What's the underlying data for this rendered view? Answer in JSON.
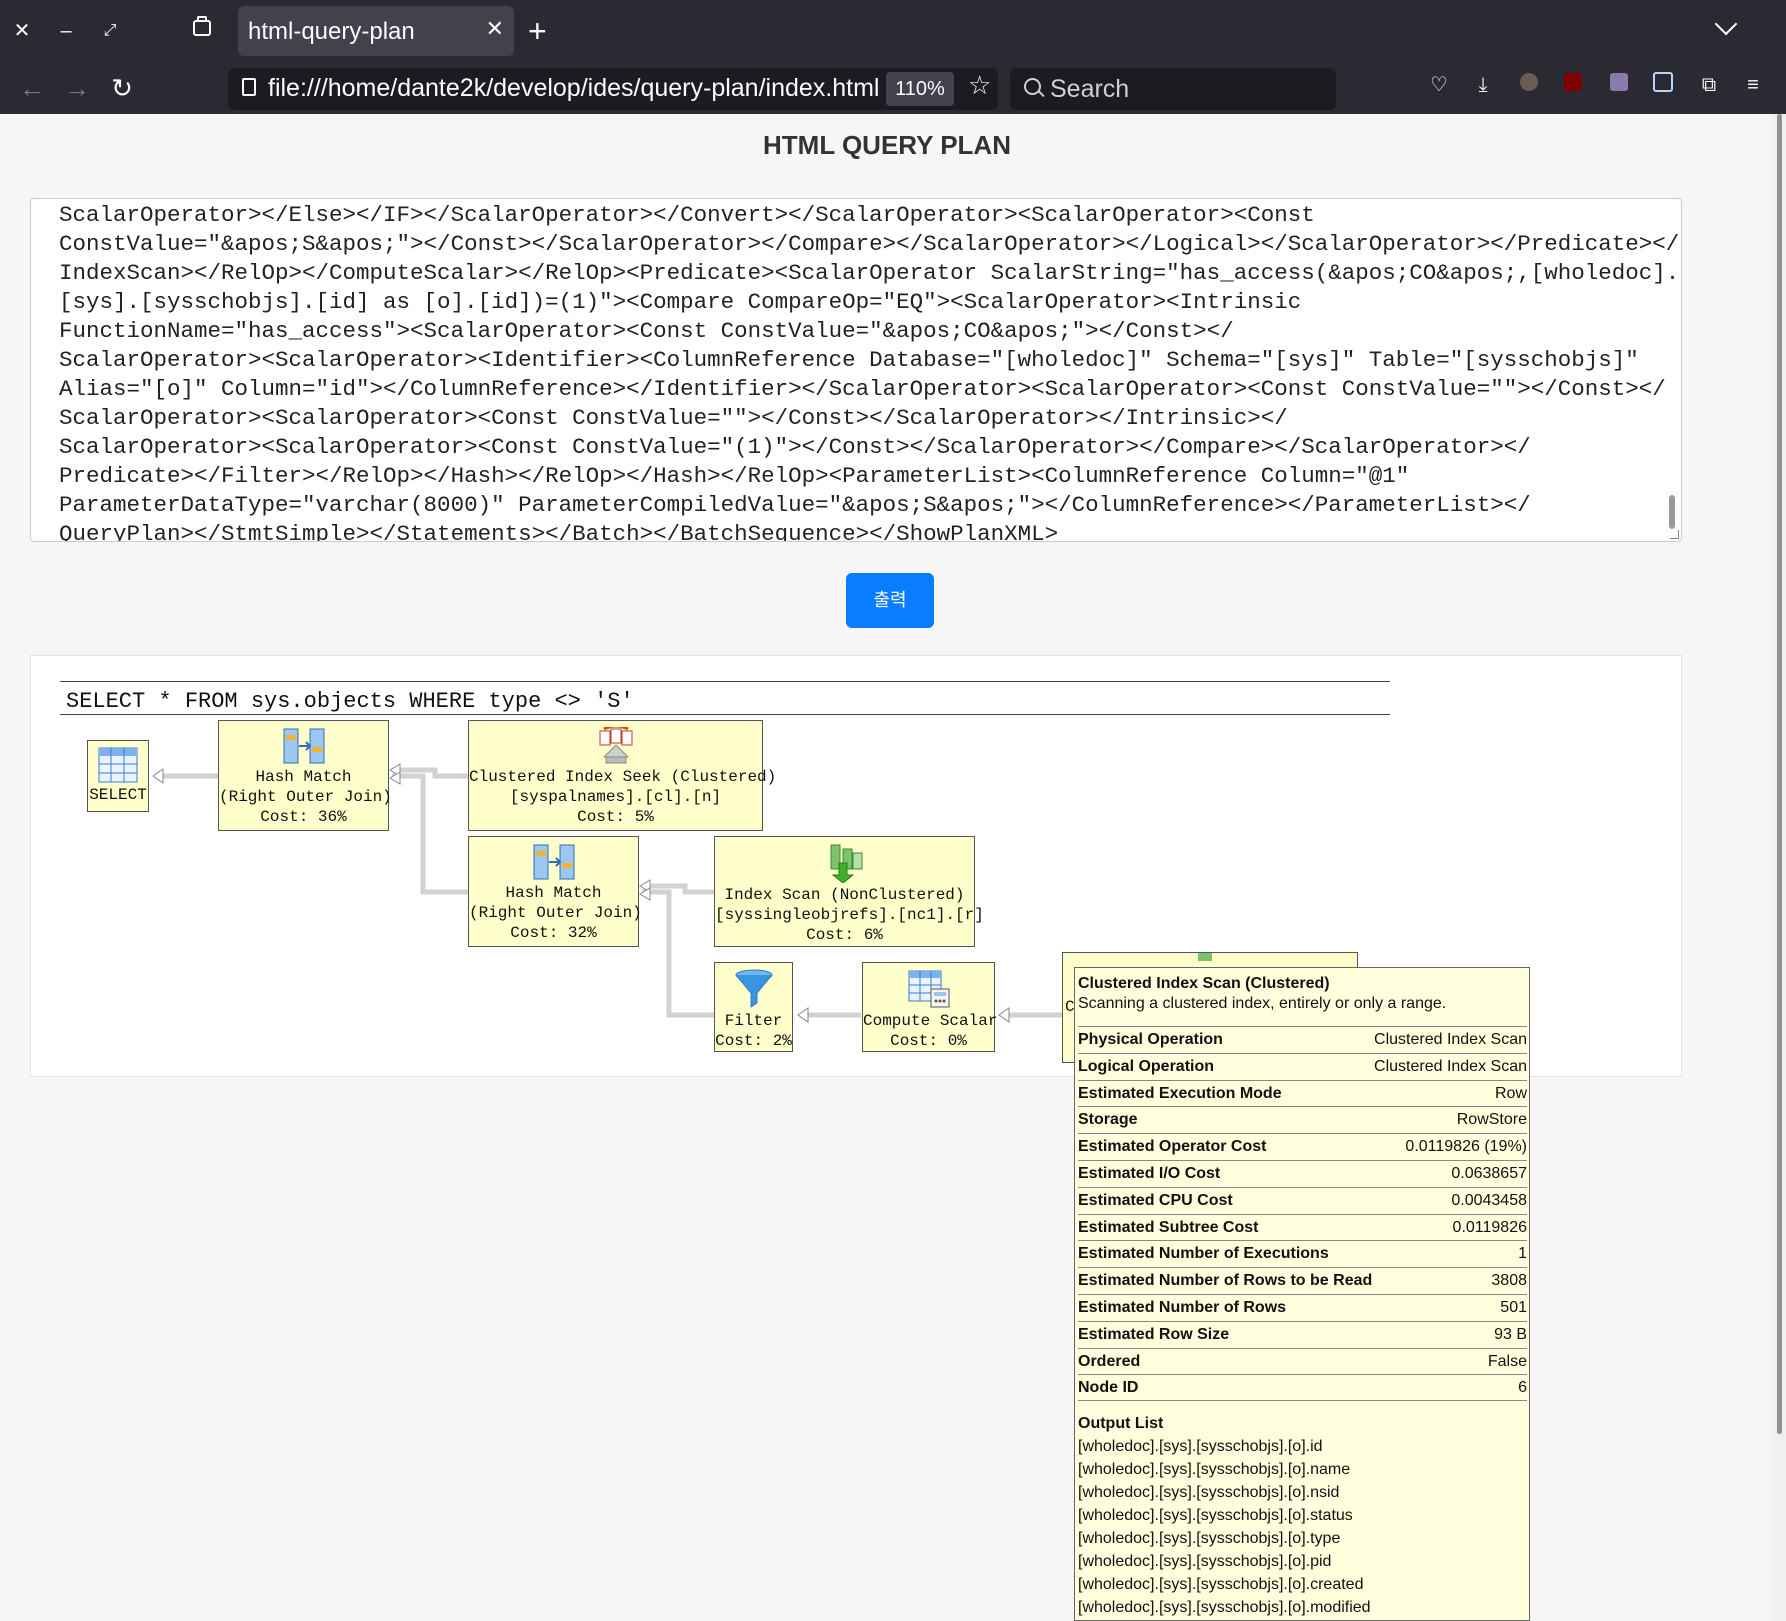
{
  "browser": {
    "tab_title": "html-query-plan",
    "url": "file:///home/dante2k/develop/ides/query-plan/index.html",
    "zoom": "110%",
    "search_placeholder": "Search"
  },
  "page": {
    "title": "HTML QUERY PLAN",
    "xml_lines": [
      "ScalarOperator></Else></IF></ScalarOperator></Convert></ScalarOperator><ScalarOperator><Const",
      "ConstValue=\"&apos;S&apos;\"></Const></ScalarOperator></Compare></ScalarOperator></Logical></ScalarOperator></Predicate></",
      "IndexScan></RelOp></ComputeScalar></RelOp><Predicate><ScalarOperator ScalarString=\"has_access(&apos;CO&apos;,[wholedoc].",
      "[sys].[sysschobjs].[id] as [o].[id])=(1)\"><Compare CompareOp=\"EQ\"><ScalarOperator><Intrinsic",
      "FunctionName=\"has_access\"><ScalarOperator><Const ConstValue=\"&apos;CO&apos;\"></Const></",
      "ScalarOperator><ScalarOperator><Identifier><ColumnReference Database=\"[wholedoc]\" Schema=\"[sys]\" Table=\"[sysschobjs]\"",
      "Alias=\"[o]\" Column=\"id\"></ColumnReference></Identifier></ScalarOperator><ScalarOperator><Const ConstValue=\"\"></Const></",
      "ScalarOperator><ScalarOperator><Const ConstValue=\"\"></Const></ScalarOperator></Intrinsic></",
      "ScalarOperator><ScalarOperator><Const ConstValue=\"(1)\"></Const></ScalarOperator></Compare></ScalarOperator></",
      "Predicate></Filter></RelOp></Hash></RelOp></Hash></RelOp><ParameterList><ColumnReference Column=\"@1\"",
      "ParameterDataType=\"varchar(8000)\" ParameterCompiledValue=\"&apos;S&apos;\"></ColumnReference></ParameterList></",
      "QueryPlan></StmtSimple></Statements></Batch></BatchSequence></ShowPlanXML>"
    ],
    "render_button": "출력"
  },
  "plan": {
    "statement": "SELECT * FROM sys.objects WHERE type <> 'S'",
    "nodes": {
      "select": {
        "l1": "SELECT"
      },
      "hash1": {
        "l1": "Hash Match",
        "l2": "(Right Outer Join)",
        "cost": "Cost: 36%"
      },
      "seek": {
        "l1": "Clustered Index Seek (Clustered)",
        "l2": "[syspalnames].[cl].[n]",
        "cost": "Cost: 5%"
      },
      "hash2": {
        "l1": "Hash Match",
        "l2": "(Right Outer Join)",
        "cost": "Cost: 32%"
      },
      "iscan": {
        "l1": "Index Scan (NonClustered)",
        "l2": "[syssingleobjrefs].[nc1].[r]",
        "cost": "Cost: 6%"
      },
      "filter": {
        "l1": "Filter",
        "cost": "Cost: 2%"
      },
      "compute": {
        "l1": "Compute Scalar",
        "cost": "Cost: 0%"
      },
      "cscan": {
        "l1": "C"
      }
    }
  },
  "tooltip": {
    "title": "Clustered Index Scan (Clustered)",
    "description": "Scanning a clustered index, entirely or only a range.",
    "rows": [
      {
        "k": "Physical Operation",
        "v": "Clustered Index Scan"
      },
      {
        "k": "Logical Operation",
        "v": "Clustered Index Scan"
      },
      {
        "k": "Estimated Execution Mode",
        "v": "Row"
      },
      {
        "k": "Storage",
        "v": "RowStore"
      },
      {
        "k": "Estimated Operator Cost",
        "v": "0.0119826 (19%)"
      },
      {
        "k": "Estimated I/O Cost",
        "v": "0.0638657"
      },
      {
        "k": "Estimated CPU Cost",
        "v": "0.0043458"
      },
      {
        "k": "Estimated Subtree Cost",
        "v": "0.0119826"
      },
      {
        "k": "Estimated Number of Executions",
        "v": "1"
      },
      {
        "k": "Estimated Number of Rows to be Read",
        "v": "3808"
      },
      {
        "k": "Estimated Number of Rows",
        "v": "501"
      },
      {
        "k": "Estimated Row Size",
        "v": "93 B"
      },
      {
        "k": "Ordered",
        "v": "False"
      },
      {
        "k": "Node ID",
        "v": "6"
      }
    ],
    "output_title": "Output List",
    "output_list": [
      "[wholedoc].[sys].[sysschobjs].[o].id",
      "[wholedoc].[sys].[sysschobjs].[o].name",
      "[wholedoc].[sys].[sysschobjs].[o].nsid",
      "[wholedoc].[sys].[sysschobjs].[o].status",
      "[wholedoc].[sys].[sysschobjs].[o].type",
      "[wholedoc].[sys].[sysschobjs].[o].pid",
      "[wholedoc].[sys].[sysschobjs].[o].created",
      "[wholedoc].[sys].[sysschobjs].[o].modified"
    ]
  },
  "icons": [
    "close-icon",
    "minimize-icon",
    "maximize-icon",
    "tab-list-icon",
    "new-tab-icon",
    "back-icon",
    "forward-icon",
    "reload-icon",
    "bookmark-star-icon",
    "pocket-icon",
    "download-icon",
    "extension-icon",
    "menu-icon"
  ],
  "colors": {
    "node_fill": "#ffffcc",
    "tooltip_fill": "#ffffdd",
    "button_blue": "#0a7cff",
    "chrome_dark": "#2b2a33"
  }
}
